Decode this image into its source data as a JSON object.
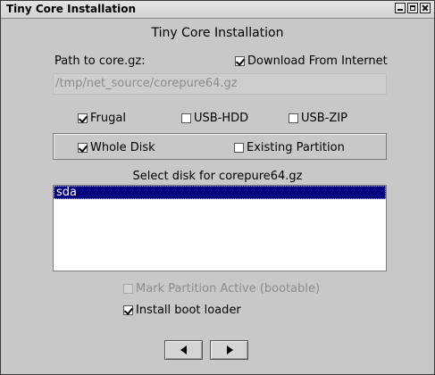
{
  "window": {
    "title": "Tiny Core Installation"
  },
  "form": {
    "heading": "Tiny Core Installation",
    "path_label": "Path to core.gz:",
    "download_label": "Download From Internet",
    "download_checked": true,
    "path_value": "/tmp/net_source/corepure64.gz",
    "install_types": [
      {
        "label": "Frugal",
        "checked": true
      },
      {
        "label": "USB-HDD",
        "checked": false
      },
      {
        "label": "USB-ZIP",
        "checked": false
      }
    ],
    "target_types": [
      {
        "label": "Whole Disk",
        "checked": true
      },
      {
        "label": "Existing Partition",
        "checked": false
      }
    ],
    "disk_label": "Select disk for corepure64.gz",
    "disks": [
      "sda"
    ],
    "selected_disk": "sda",
    "mark_active_label": "Mark Partition Active (bootable)",
    "mark_active_checked": false,
    "bootloader_label": "Install boot loader",
    "bootloader_checked": true
  },
  "nav": {
    "prev_icon": "arrow-left-icon",
    "next_icon": "arrow-right-icon"
  }
}
